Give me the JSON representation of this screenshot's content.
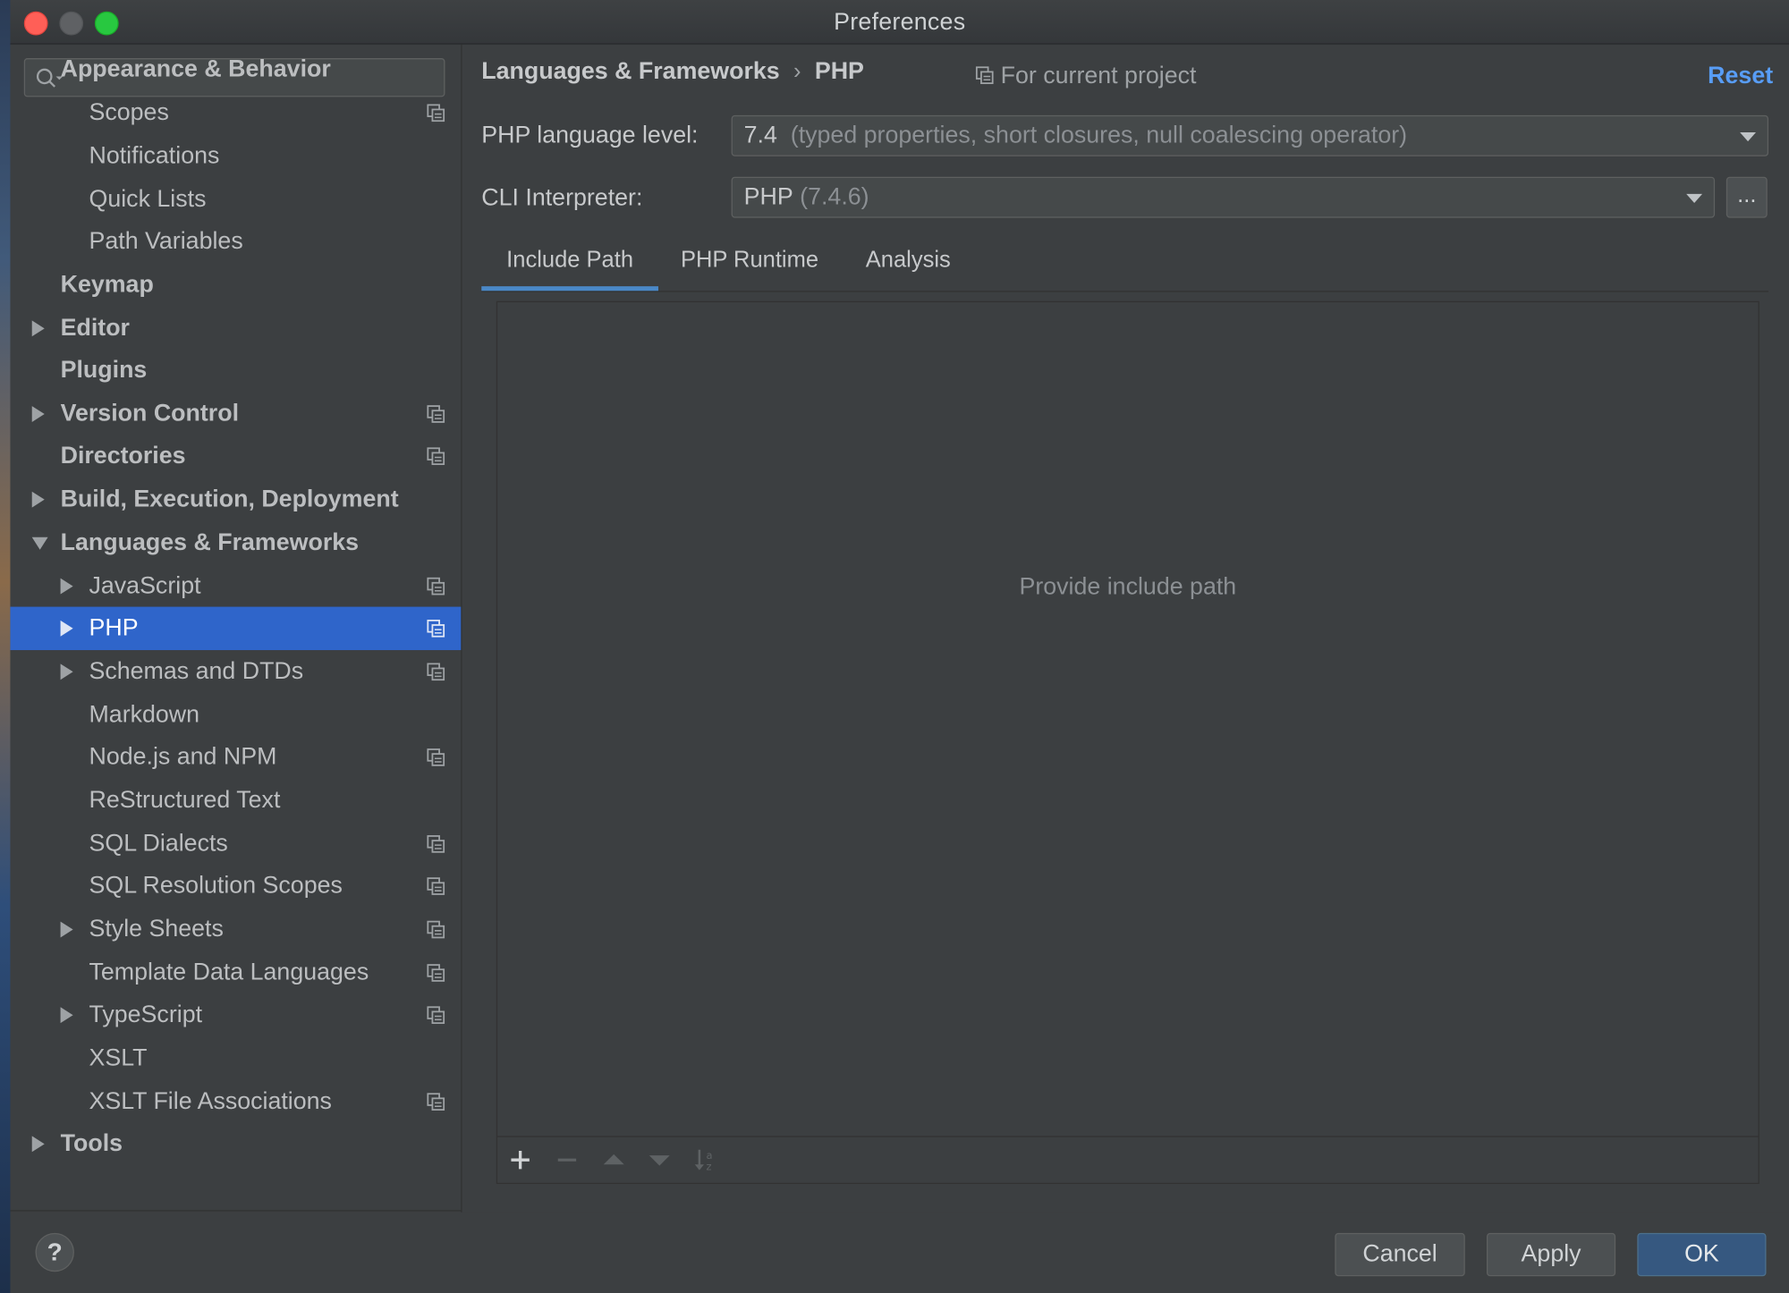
{
  "window": {
    "title": "Preferences"
  },
  "search": {
    "placeholder": "",
    "value": ""
  },
  "sidebar": {
    "items": [
      {
        "label": "Appearance & Behavior",
        "level": 0,
        "bold": true,
        "arrow": "none",
        "project": false
      },
      {
        "label": "Scopes",
        "level": 1,
        "bold": false,
        "arrow": "none",
        "project": true
      },
      {
        "label": "Notifications",
        "level": 1,
        "bold": false,
        "arrow": "none",
        "project": false
      },
      {
        "label": "Quick Lists",
        "level": 1,
        "bold": false,
        "arrow": "none",
        "project": false
      },
      {
        "label": "Path Variables",
        "level": 1,
        "bold": false,
        "arrow": "none",
        "project": false
      },
      {
        "label": "Keymap",
        "level": 0,
        "bold": true,
        "arrow": "none",
        "project": false
      },
      {
        "label": "Editor",
        "level": 0,
        "bold": true,
        "arrow": "right",
        "project": false
      },
      {
        "label": "Plugins",
        "level": 0,
        "bold": true,
        "arrow": "none",
        "project": false
      },
      {
        "label": "Version Control",
        "level": 0,
        "bold": true,
        "arrow": "right",
        "project": true
      },
      {
        "label": "Directories",
        "level": 0,
        "bold": true,
        "arrow": "none",
        "project": true
      },
      {
        "label": "Build, Execution, Deployment",
        "level": 0,
        "bold": true,
        "arrow": "right",
        "project": false
      },
      {
        "label": "Languages & Frameworks",
        "level": 0,
        "bold": true,
        "arrow": "down",
        "project": false
      },
      {
        "label": "JavaScript",
        "level": 1,
        "bold": false,
        "arrow": "right",
        "project": true
      },
      {
        "label": "PHP",
        "level": 1,
        "bold": false,
        "arrow": "right",
        "project": true,
        "selected": true
      },
      {
        "label": "Schemas and DTDs",
        "level": 1,
        "bold": false,
        "arrow": "right",
        "project": true
      },
      {
        "label": "Markdown",
        "level": 1,
        "bold": false,
        "arrow": "none",
        "project": false
      },
      {
        "label": "Node.js and NPM",
        "level": 1,
        "bold": false,
        "arrow": "none",
        "project": true
      },
      {
        "label": "ReStructured Text",
        "level": 1,
        "bold": false,
        "arrow": "none",
        "project": false
      },
      {
        "label": "SQL Dialects",
        "level": 1,
        "bold": false,
        "arrow": "none",
        "project": true
      },
      {
        "label": "SQL Resolution Scopes",
        "level": 1,
        "bold": false,
        "arrow": "none",
        "project": true
      },
      {
        "label": "Style Sheets",
        "level": 1,
        "bold": false,
        "arrow": "right",
        "project": true
      },
      {
        "label": "Template Data Languages",
        "level": 1,
        "bold": false,
        "arrow": "none",
        "project": true
      },
      {
        "label": "TypeScript",
        "level": 1,
        "bold": false,
        "arrow": "right",
        "project": true
      },
      {
        "label": "XSLT",
        "level": 1,
        "bold": false,
        "arrow": "none",
        "project": false
      },
      {
        "label": "XSLT File Associations",
        "level": 1,
        "bold": false,
        "arrow": "none",
        "project": true
      },
      {
        "label": "Tools",
        "level": 0,
        "bold": true,
        "arrow": "right",
        "project": false
      }
    ]
  },
  "header": {
    "breadcrumb_parent": "Languages & Frameworks",
    "breadcrumb_separator": "›",
    "breadcrumb_current": "PHP",
    "scope_note": "For current project",
    "reset_label": "Reset"
  },
  "form": {
    "language_level_label": "PHP language level:",
    "language_level_value": "7.4",
    "language_level_detail": "(typed properties, short closures, null coalescing operator)",
    "cli_label": "CLI Interpreter:",
    "cli_value": "PHP",
    "cli_detail": "(7.4.6)",
    "more_button": "..."
  },
  "tabs": [
    {
      "label": "Include Path",
      "active": true
    },
    {
      "label": "PHP Runtime",
      "active": false
    },
    {
      "label": "Analysis",
      "active": false
    }
  ],
  "include_path": {
    "empty_text": "Provide include path",
    "toolbar": [
      "add-icon",
      "remove-icon",
      "move-up-icon",
      "move-down-icon",
      "sort-icon"
    ]
  },
  "footer": {
    "help_label": "?",
    "cancel_label": "Cancel",
    "apply_label": "Apply",
    "ok_label": "OK"
  },
  "colors": {
    "background": "#3c3f41",
    "selection": "#2f65ca",
    "link": "#589df6",
    "tab_underline": "#4a88c7",
    "primary_button": "#365880"
  }
}
